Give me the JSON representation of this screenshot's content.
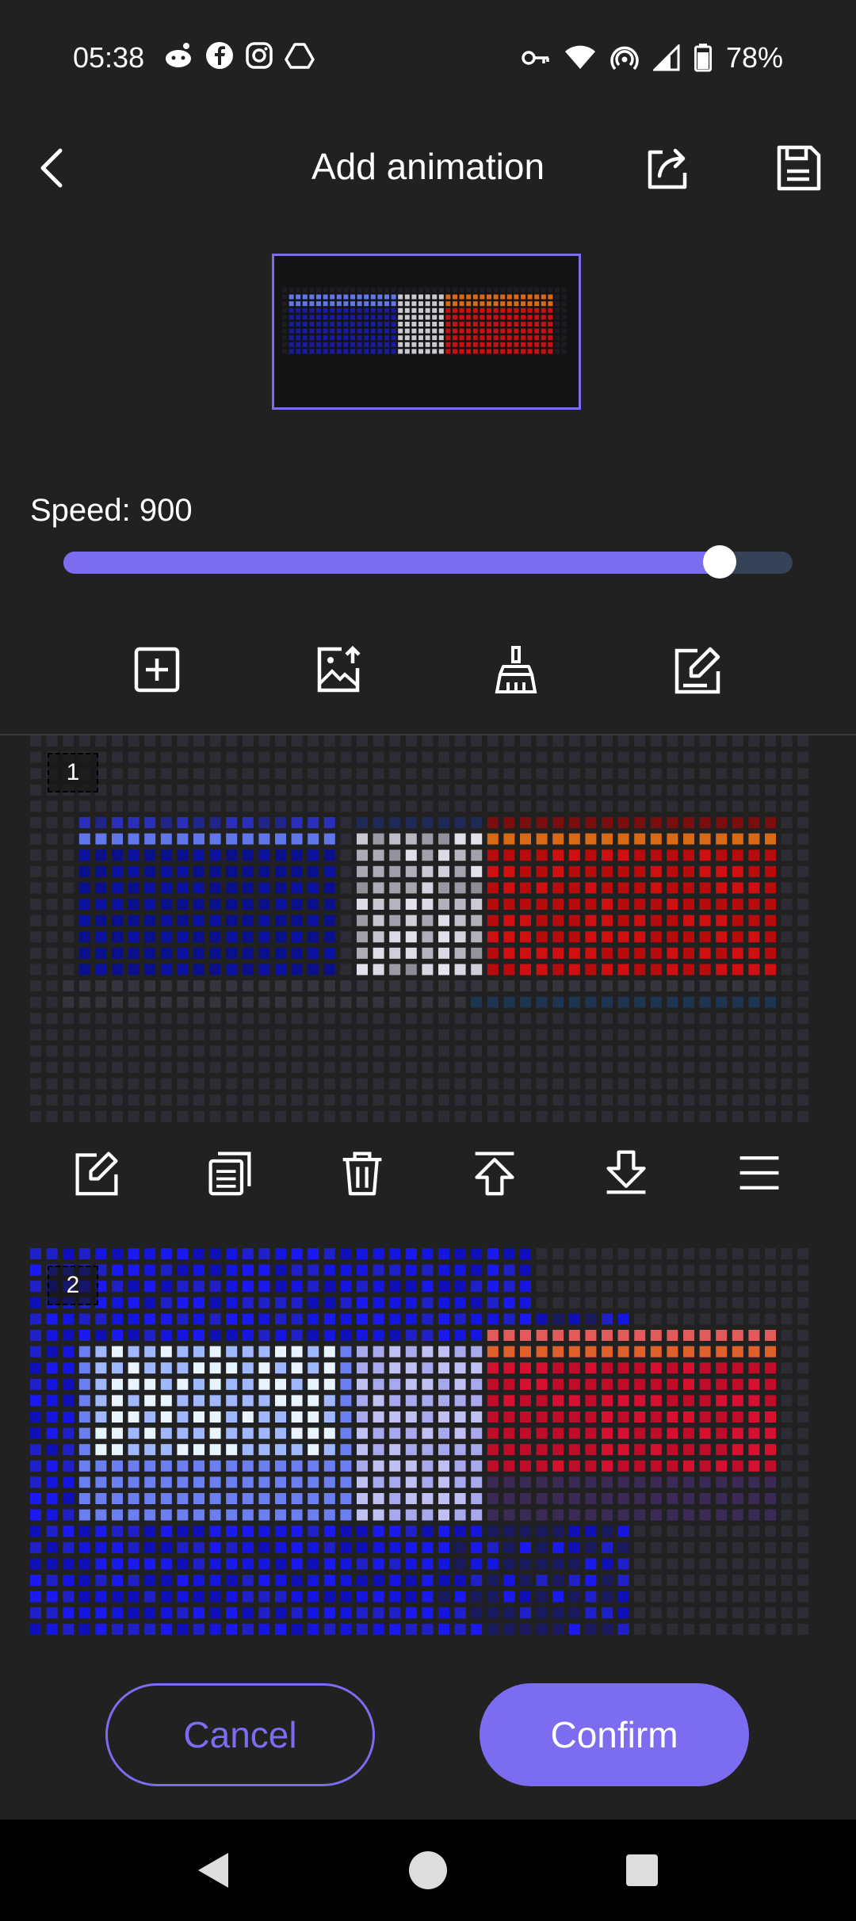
{
  "status_bar": {
    "time": "05:38",
    "left_icons": [
      "reddit-icon",
      "facebook-icon",
      "instagram-icon",
      "drive-icon"
    ],
    "right_icons": [
      "key-icon",
      "wifi-icon",
      "hotspot-icon",
      "signal-icon",
      "battery-icon"
    ],
    "battery": "78%"
  },
  "header": {
    "title": "Add animation",
    "back_icon": "chevron-left-icon",
    "share_icon": "share-icon",
    "save_icon": "save-icon"
  },
  "speed": {
    "label": "Speed: 900",
    "value": 900,
    "fraction": 0.9
  },
  "tools": [
    "add-frame-icon",
    "import-image-icon",
    "clear-brush-icon",
    "edit-icon"
  ],
  "frames": [
    {
      "number": "1"
    },
    {
      "number": "2"
    }
  ],
  "frame_actions": [
    "edit-icon",
    "copy-icon",
    "delete-icon",
    "move-top-icon",
    "move-down-icon",
    "menu-icon"
  ],
  "buttons": {
    "cancel": "Cancel",
    "confirm": "Confirm"
  },
  "colors": {
    "accent": "#7b6cf0",
    "background": "#212121",
    "track": "#364258"
  }
}
